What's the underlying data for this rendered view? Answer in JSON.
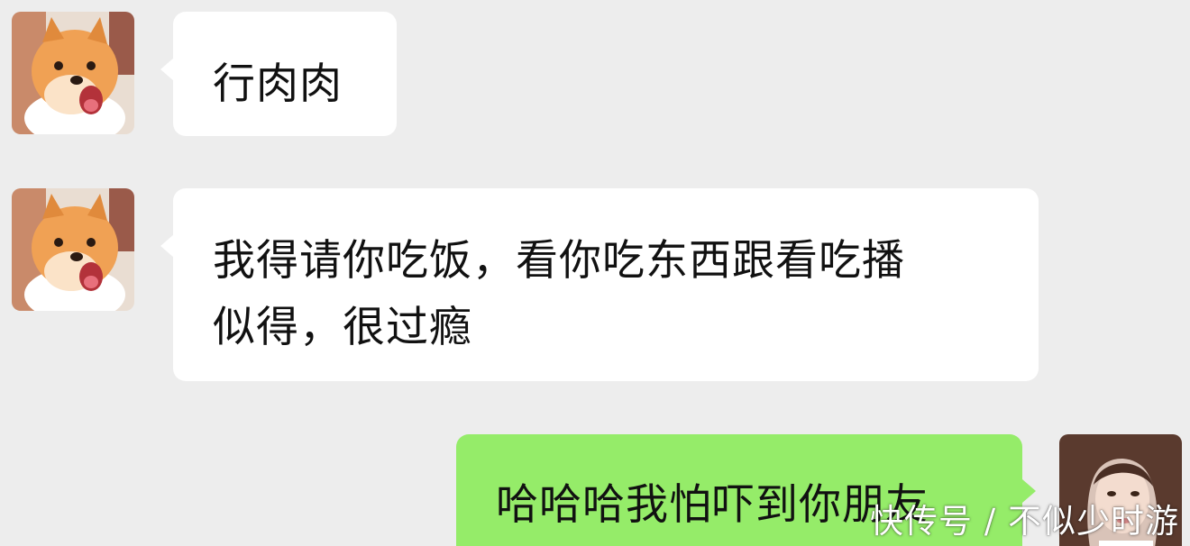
{
  "messages": [
    {
      "sender": "other",
      "avatar": "pomeranian-dog-avatar",
      "text": "行肉肉"
    },
    {
      "sender": "other",
      "avatar": "pomeranian-dog-avatar",
      "text_line1": "我得请你吃饭，看你吃东西跟看吃播",
      "text_line2": "似得，很过瘾"
    },
    {
      "sender": "self",
      "avatar": "woman-portrait-avatar",
      "text": "哈哈哈我怕吓到你朋友"
    }
  ],
  "watermark": "快传号 / 不似少时游",
  "colors": {
    "background": "#ededed",
    "incoming_bubble": "#ffffff",
    "outgoing_bubble": "#95ec69"
  }
}
